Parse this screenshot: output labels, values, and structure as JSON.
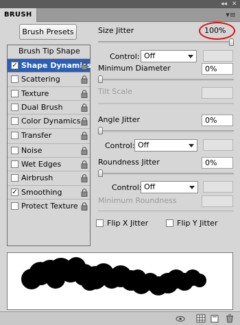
{
  "titlebar": {
    "collapse_glyph": "◂◂",
    "close_glyph": "✕"
  },
  "tab": {
    "label": "BRUSH"
  },
  "panel_menu": {
    "glyph": "▾≡"
  },
  "brush_presets_button": "Brush Presets",
  "brush_tip_shape": "Brush Tip Shape",
  "options": [
    {
      "label": "Shape Dynamics",
      "checked": true,
      "selected": true
    },
    {
      "label": "Scattering",
      "checked": false
    },
    {
      "label": "Texture",
      "checked": false
    },
    {
      "label": "Dual Brush",
      "checked": false
    },
    {
      "label": "Color Dynamics",
      "checked": false
    },
    {
      "label": "Transfer",
      "checked": false
    },
    {
      "label": "Noise",
      "checked": false
    },
    {
      "label": "Wet Edges",
      "checked": false
    },
    {
      "label": "Airbrush",
      "checked": false
    },
    {
      "label": "Smoothing",
      "checked": true
    },
    {
      "label": "Protect Texture",
      "checked": false
    }
  ],
  "check_glyph": "✓",
  "settings": {
    "size_jitter": {
      "label": "Size Jitter",
      "value": "100%",
      "level": 1.0
    },
    "size_control": {
      "label": "Control:",
      "value": "Off"
    },
    "minimum_diameter": {
      "label": "Minimum Diameter",
      "value": "0%",
      "level": 0.0
    },
    "tilt_scale": {
      "label": "Tilt Scale"
    },
    "angle_jitter": {
      "label": "Angle Jitter",
      "value": "0%",
      "level": 0.0
    },
    "angle_control": {
      "label": "Control:",
      "value": "Off"
    },
    "roundness_jitter": {
      "label": "Roundness Jitter",
      "value": "0%",
      "level": 0.0
    },
    "roundness_control": {
      "label": "Control:",
      "value": "Off"
    },
    "minimum_roundness": {
      "label": "Minimum Roundness"
    },
    "flip_x": {
      "label": "Flip X Jitter",
      "checked": false
    },
    "flip_y": {
      "label": "Flip Y Jitter",
      "checked": false
    }
  },
  "colors": {
    "selection": "#2b5fb5",
    "highlight_ring": "#e01010",
    "panel_bg": "#d6d6d6"
  },
  "bottom_icons": [
    "eye-brush-icon",
    "grid-icon",
    "new-preset-icon",
    "trash-icon"
  ]
}
